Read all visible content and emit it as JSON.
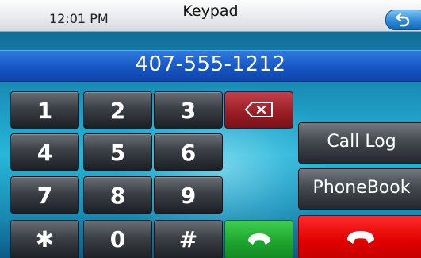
{
  "statusbar": {
    "time": "12:01 PM",
    "title": "Keypad"
  },
  "dial": {
    "number": "407-555-1212"
  },
  "keys": [
    "1",
    "2",
    "3",
    "4",
    "5",
    "6",
    "7",
    "8",
    "9",
    "✱",
    "0",
    "#"
  ],
  "buttons": {
    "call_log": "Call Log",
    "phonebook": "PhoneBook"
  },
  "icons": {
    "back": "back-arrow-icon",
    "delete": "backspace-icon",
    "call": "phone-handset-icon",
    "end": "hang-up-icon"
  },
  "colors": {
    "number_bar": "#1756c4",
    "delete": "#9b1e27",
    "call": "#1ea52f",
    "end": "#e00000"
  }
}
